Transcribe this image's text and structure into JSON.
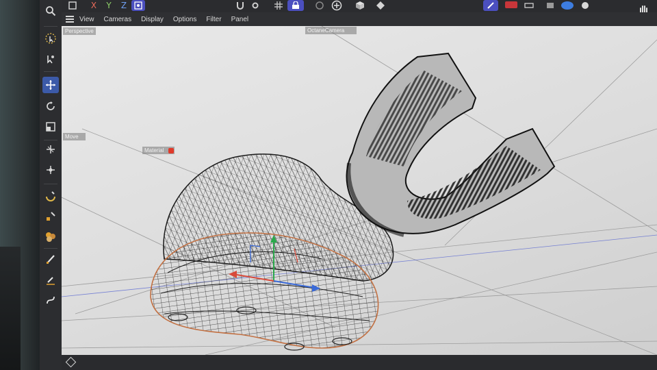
{
  "toolbar_top": {
    "axis_x": "X",
    "axis_y": "Y",
    "axis_z": "Z"
  },
  "menubar": {
    "items": [
      "View",
      "Cameras",
      "Display",
      "Options",
      "Filter",
      "Panel"
    ]
  },
  "viewport": {
    "perspective_label": "Perspective",
    "camera_label": "OctaneCamera",
    "move_label": "Move",
    "material_label": "Material"
  },
  "icons": {
    "left_toolbar": [
      "search-icon",
      "live-selection-icon",
      "select-tools-icon",
      "move-icon",
      "rotate-icon",
      "scale-icon",
      "move-tool-icon",
      "transform-icon",
      "magnet-icon",
      "paint-icon",
      "material-icon",
      "brush-icon",
      "pen-icon",
      "spline-icon"
    ]
  },
  "colors": {
    "accent_active": "#4b4fbf",
    "viewport_bg": "#e3e3e3",
    "axis_red": "#e86a5a",
    "axis_green": "#8fd16a",
    "axis_blue": "#6f9ef0"
  }
}
